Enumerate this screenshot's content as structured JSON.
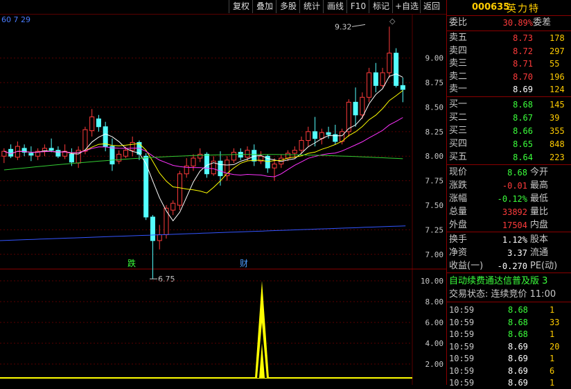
{
  "toolbar": {
    "buttons": [
      "复权",
      "叠加",
      "多股",
      "统计",
      "画线",
      "F10",
      "标记",
      "+自选",
      "返回"
    ]
  },
  "indicator_label": "60 7 29",
  "stock": {
    "code": "000635",
    "name": "英力特"
  },
  "weibi": {
    "label": "委比",
    "value": "30.89%",
    "label2": "委差"
  },
  "sell": [
    {
      "label": "卖五",
      "price": "8.73",
      "vol": "178"
    },
    {
      "label": "卖四",
      "price": "8.72",
      "vol": "297"
    },
    {
      "label": "卖三",
      "price": "8.71",
      "vol": "55"
    },
    {
      "label": "卖二",
      "price": "8.70",
      "vol": "196"
    },
    {
      "label": "卖一",
      "price": "8.69",
      "vol": "124"
    }
  ],
  "buy": [
    {
      "label": "买一",
      "price": "8.68",
      "vol": "145"
    },
    {
      "label": "买二",
      "price": "8.67",
      "vol": "39"
    },
    {
      "label": "买三",
      "price": "8.66",
      "vol": "355"
    },
    {
      "label": "买四",
      "price": "8.65",
      "vol": "848"
    },
    {
      "label": "买五",
      "price": "8.64",
      "vol": "223"
    }
  ],
  "stats": [
    {
      "label": "现价",
      "value": "8.68",
      "label2": "今开"
    },
    {
      "label": "涨跌",
      "value": "-0.01",
      "label2": "最高"
    },
    {
      "label": "涨幅",
      "value": "-0.12%",
      "label2": "最低"
    },
    {
      "label": "总量",
      "value": "33892",
      "label2": "量比"
    },
    {
      "label": "外盘",
      "value": "17504",
      "label2": "内盘"
    }
  ],
  "stats2": [
    {
      "label": "换手",
      "value": "1.12%",
      "label2": "股本"
    },
    {
      "label": "净资",
      "value": "3.37",
      "label2": "流通"
    },
    {
      "label": "收益(一)",
      "value": "-0.270",
      "label2": "PE(动)"
    }
  ],
  "news_line": "自动续费通达信普及版 3",
  "trade_status": "交易状态: 连续竞价 11:00",
  "ticks": [
    {
      "time": "10:59",
      "price": "8.68",
      "vol": "1"
    },
    {
      "time": "10:59",
      "price": "8.68",
      "vol": "33"
    },
    {
      "time": "10:59",
      "price": "8.68",
      "vol": "1"
    },
    {
      "time": "10:59",
      "price": "8.69",
      "vol": "20"
    },
    {
      "time": "10:59",
      "price": "8.69",
      "vol": "1"
    },
    {
      "time": "10:59",
      "price": "8.69",
      "vol": "6"
    },
    {
      "time": "10:59",
      "price": "8.69",
      "vol": "1"
    }
  ],
  "chart_data": {
    "type": "candlestick",
    "price_axis": {
      "ticks": [
        "9.00",
        "8.75",
        "8.50",
        "8.25",
        "8.00",
        "7.75",
        "7.50",
        "7.25",
        "7.00"
      ],
      "ylim": [
        6.85,
        9.45
      ]
    },
    "annotations": [
      {
        "text": "9.32",
        "price": 9.32
      },
      {
        "text": "6.75",
        "price": 6.75
      }
    ],
    "markers": [
      {
        "text": "跌",
        "color": "#3bff3b"
      },
      {
        "text": "财",
        "color": "#4a9cff"
      }
    ],
    "candles": [
      [
        8.0,
        8.08,
        7.93,
        8.05
      ],
      [
        8.07,
        8.12,
        7.98,
        8.0
      ],
      [
        7.99,
        8.15,
        7.96,
        8.1
      ],
      [
        8.08,
        8.12,
        8.0,
        8.04
      ],
      [
        8.03,
        8.1,
        7.95,
        8.01
      ],
      [
        8.0,
        8.08,
        7.96,
        8.05
      ],
      [
        8.05,
        8.12,
        8.0,
        8.08
      ],
      [
        8.08,
        8.18,
        8.04,
        8.06
      ],
      [
        8.06,
        8.1,
        7.98,
        8.0
      ],
      [
        8.0,
        8.12,
        7.97,
        8.05
      ],
      [
        8.02,
        8.08,
        7.9,
        7.94
      ],
      [
        7.93,
        8.1,
        7.88,
        8.06
      ],
      [
        8.05,
        8.3,
        8.02,
        8.27
      ],
      [
        8.26,
        8.48,
        8.2,
        8.4
      ],
      [
        8.38,
        8.42,
        8.25,
        8.3
      ],
      [
        8.3,
        8.35,
        8.05,
        8.1
      ],
      [
        8.1,
        8.18,
        7.85,
        7.92
      ],
      [
        7.95,
        8.06,
        7.92,
        8.02
      ],
      [
        8.0,
        8.1,
        7.98,
        8.06
      ],
      [
        8.06,
        8.2,
        8.0,
        8.14
      ],
      [
        8.14,
        8.16,
        7.96,
        8.02
      ],
      [
        8.0,
        8.03,
        7.35,
        7.38
      ],
      [
        7.38,
        7.4,
        6.75,
        7.14
      ],
      [
        7.14,
        7.3,
        7.05,
        7.2
      ],
      [
        7.2,
        7.5,
        7.16,
        7.47
      ],
      [
        7.45,
        7.55,
        7.4,
        7.52
      ],
      [
        7.5,
        7.85,
        7.45,
        7.82
      ],
      [
        7.82,
        7.98,
        7.78,
        7.9
      ],
      [
        7.9,
        8.02,
        7.85,
        7.98
      ],
      [
        7.98,
        8.08,
        7.94,
        8.02
      ],
      [
        8.02,
        8.04,
        7.78,
        7.82
      ],
      [
        7.82,
        8.0,
        7.8,
        7.95
      ],
      [
        7.95,
        8.05,
        7.7,
        7.8
      ],
      [
        7.8,
        8.0,
        7.75,
        7.96
      ],
      [
        7.96,
        8.08,
        7.93,
        8.04
      ],
      [
        8.04,
        8.08,
        7.96,
        7.99
      ],
      [
        7.99,
        8.1,
        7.95,
        8.06
      ],
      [
        8.06,
        8.12,
        7.9,
        7.95
      ],
      [
        7.95,
        8.05,
        7.92,
        8.0
      ],
      [
        8.0,
        8.02,
        7.83,
        7.88
      ],
      [
        7.88,
        7.98,
        7.75,
        7.92
      ],
      [
        7.92,
        8.02,
        7.88,
        7.98
      ],
      [
        7.98,
        8.06,
        7.95,
        8.03
      ],
      [
        8.03,
        8.1,
        7.98,
        8.06
      ],
      [
        8.06,
        8.2,
        8.02,
        8.16
      ],
      [
        8.16,
        8.3,
        8.1,
        8.25
      ],
      [
        8.25,
        8.4,
        8.1,
        8.18
      ],
      [
        8.18,
        8.28,
        8.12,
        8.24
      ],
      [
        8.24,
        8.3,
        8.18,
        8.22
      ],
      [
        8.22,
        8.32,
        8.12,
        8.15
      ],
      [
        8.15,
        8.28,
        8.12,
        8.25
      ],
      [
        8.25,
        8.58,
        8.2,
        8.55
      ],
      [
        8.55,
        8.7,
        8.3,
        8.42
      ],
      [
        8.42,
        8.65,
        8.38,
        8.6
      ],
      [
        8.6,
        8.9,
        8.55,
        8.85
      ],
      [
        8.85,
        8.95,
        8.65,
        8.72
      ],
      [
        8.72,
        8.9,
        8.7,
        8.85
      ],
      [
        8.85,
        9.32,
        8.8,
        9.05
      ],
      [
        9.05,
        9.1,
        8.7,
        8.72
      ],
      [
        8.72,
        8.8,
        8.55,
        8.68
      ]
    ],
    "ma_lines": [
      {
        "name": "MA5",
        "color": "#ffffff"
      },
      {
        "name": "MA10",
        "color": "#ffff00"
      },
      {
        "name": "MA20",
        "color": "#ff33ff"
      },
      {
        "name": "MA60",
        "color": "#33cc33"
      },
      {
        "name": "MA250",
        "color": "#3355ff"
      }
    ],
    "volume_axis": {
      "ticks": [
        "10.00",
        "8.00",
        "6.00",
        "4.00",
        "2.00"
      ],
      "ylim": [
        0,
        11
      ]
    },
    "volume_spike": {
      "index": 43,
      "values": [
        10,
        6,
        4
      ]
    }
  }
}
